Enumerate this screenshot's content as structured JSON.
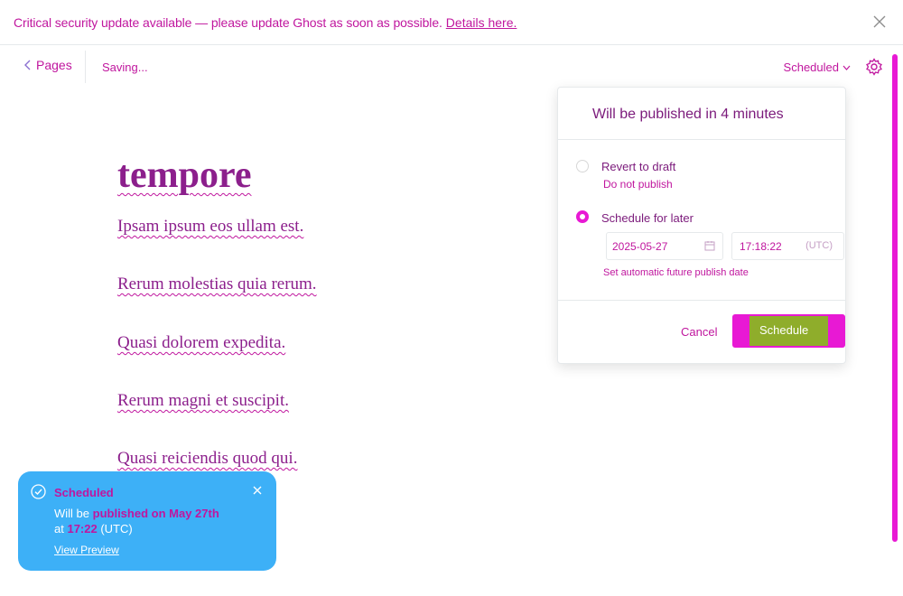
{
  "banner": {
    "message": "Critical security update available — please update Ghost as soon as possible.",
    "link": "Details here."
  },
  "topbar": {
    "back_label": "Pages",
    "saving": "Saving...",
    "status": "Scheduled"
  },
  "editor": {
    "title": "tempore",
    "paragraphs": [
      "Ipsam ipsum eos ullam est.",
      "Rerum molestias quia rerum.",
      "Quasi dolorem expedita.",
      "Rerum magni et suscipit.",
      "Quasi reiciendis quod qui."
    ]
  },
  "publish_panel": {
    "heading": "Will be published in 4 minutes",
    "revert_label": "Revert to draft",
    "revert_desc": "Do not publish",
    "schedule_label": "Schedule for later",
    "date_value": "2025-05-27",
    "time_value": "17:18:22",
    "timezone": "(UTC)",
    "hint": "Set automatic future publish date",
    "cancel_label": "Cancel",
    "submit_label": "Schedule"
  },
  "toast": {
    "title": "Scheduled",
    "line1_prefix": "Will be",
    "line1_value": "published on May 27th",
    "line2_prefix": "at",
    "line2_value": "17:22",
    "line2_suffix": "(UTC)",
    "link": "View Preview"
  },
  "colors": {
    "accent": "#e819d4",
    "text_accent": "#c0169e",
    "toast_bg": "#3db0f7"
  }
}
